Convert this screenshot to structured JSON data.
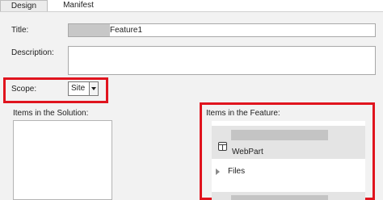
{
  "tabs": [
    {
      "label": "Design",
      "active": true
    },
    {
      "label": "Manifest",
      "active": false
    }
  ],
  "form": {
    "title_label": "Title:",
    "title_value": "Feature1",
    "description_label": "Description:",
    "description_value": "",
    "scope_label": "Scope:",
    "scope_value": "Site"
  },
  "solution": {
    "label": "Items in the Solution:"
  },
  "feature": {
    "label": "Items in the Feature:",
    "webpart_label": "WebPart",
    "files_label": "Files"
  },
  "colors": {
    "highlight": "#e0141e",
    "panel": "#f2f2f2",
    "redaction": "#c4c4c4"
  }
}
